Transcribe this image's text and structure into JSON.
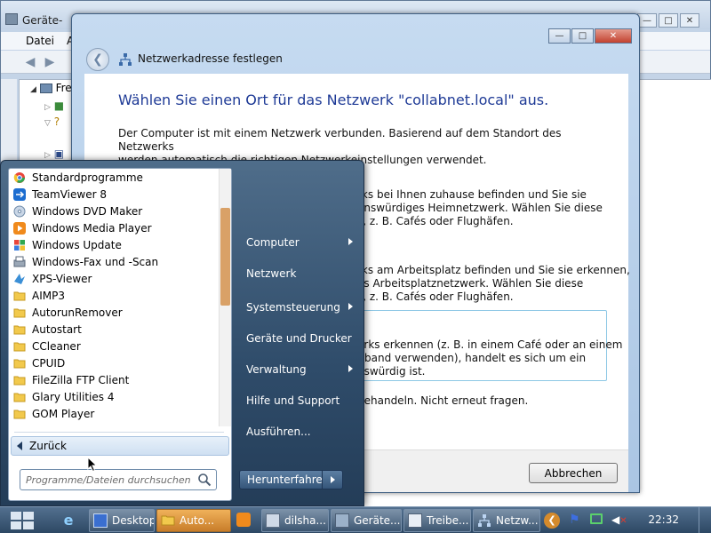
{
  "background_window": {
    "title": "Geräte-",
    "menu": [
      "Datei",
      "A"
    ],
    "tree_root": "Fre"
  },
  "dialog": {
    "title": "Netzwerkadresse festlegen",
    "heading": "Wählen Sie einen Ort für das Netzwerk \"collabnet.local\" aus.",
    "intro_line1": "Der Computer ist mit einem Netzwerk verbunden. Basierend auf dem Standort des Netzwerks",
    "intro_line2": "werden automatisch die richtigen Netzwerkeinstellungen verwendet.",
    "home_line1": "rks bei Ihnen zuhause befinden und Sie sie",
    "home_line2": "enswürdiges Heimnetzwerk. Wählen Sie diese",
    "home_line3": "s, z. B. Cafés oder Flughäfen.",
    "work_line1": "rks am Arbeitsplatz befinden und Sie sie erkennen,",
    "work_line2": "es Arbeitsplatznetzwerk. Wählen Sie diese",
    "work_line3": "s, z. B. Cafés oder Flughäfen.",
    "public_line1": "erks erkennen (z. B. in einem Café oder an einem",
    "public_line2": "itband verwenden), handelt es sich um ein",
    "public_line3": "nswürdig ist.",
    "treat_all": "behandeln. Nicht erneut fragen.",
    "cancel_label": "Abbrechen"
  },
  "start_menu": {
    "programs": [
      {
        "label": "Standardprogramme",
        "icon": "default-programs-icon"
      },
      {
        "label": "TeamViewer 8",
        "icon": "teamviewer-icon"
      },
      {
        "label": "Windows DVD Maker",
        "icon": "dvd-maker-icon"
      },
      {
        "label": "Windows Media Player",
        "icon": "media-player-icon"
      },
      {
        "label": "Windows Update",
        "icon": "windows-update-icon"
      },
      {
        "label": "Windows-Fax und -Scan",
        "icon": "fax-scan-icon"
      },
      {
        "label": "XPS-Viewer",
        "icon": "xps-viewer-icon"
      },
      {
        "label": "AIMP3",
        "icon": "folder-icon"
      },
      {
        "label": "AutorunRemover",
        "icon": "folder-icon"
      },
      {
        "label": "Autostart",
        "icon": "folder-icon"
      },
      {
        "label": "CCleaner",
        "icon": "folder-icon"
      },
      {
        "label": "CPUID",
        "icon": "folder-icon"
      },
      {
        "label": "FileZilla FTP Client",
        "icon": "folder-icon"
      },
      {
        "label": "Glary Utilities 4",
        "icon": "folder-icon"
      },
      {
        "label": "GOM Player",
        "icon": "folder-icon"
      }
    ],
    "back_label": "Zurück",
    "search_placeholder": "Programme/Dateien durchsuchen",
    "right_items": [
      {
        "label": "Computer",
        "submenu": true
      },
      {
        "label": "Netzwerk",
        "submenu": false
      },
      {
        "label": "Systemsteuerung",
        "submenu": true
      },
      {
        "label": "Geräte und Drucker",
        "submenu": false
      },
      {
        "label": "Verwaltung",
        "submenu": true
      },
      {
        "label": "Hilfe und Support",
        "submenu": false
      },
      {
        "label": "Ausführen...",
        "submenu": false
      }
    ],
    "shutdown_label": "Herunterfahren"
  },
  "taskbar": {
    "buttons": [
      {
        "label": "Desktop",
        "icon": "desktop-icon",
        "active": false
      },
      {
        "label": "Auto...",
        "icon": "folder-icon",
        "active": true
      },
      {
        "label": "dilsha...",
        "icon": "explorer-icon",
        "active": false
      },
      {
        "label": "Geräte...",
        "icon": "device-manager-icon",
        "active": false
      },
      {
        "label": "Treibe...",
        "icon": "driver-icon",
        "active": false
      },
      {
        "label": "Netzw...",
        "icon": "network-icon",
        "active": false
      }
    ],
    "clock": "22:32"
  },
  "colors": {
    "heading_blue": "#1e3a96",
    "active_task": "#e0962e",
    "folder_yellow": "#f2c94c"
  }
}
